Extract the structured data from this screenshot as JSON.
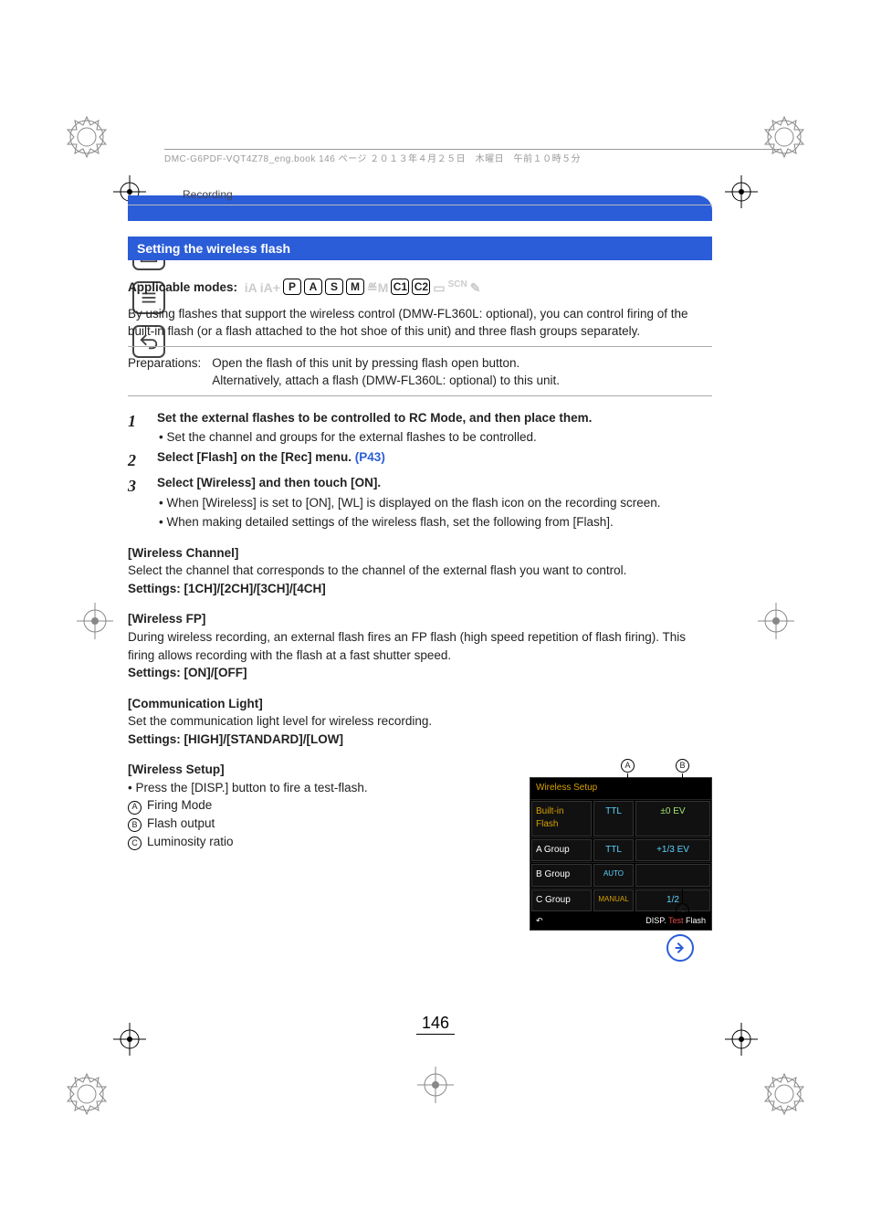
{
  "header_stamp": "DMC-G6PDF-VQT4Z78_eng.book  146 ページ  ２０１３年４月２５日　木曜日　午前１０時５分",
  "section": "Recording",
  "title": "Setting the wireless flash",
  "applicable_label": "Applicable modes:",
  "modes": {
    "dim1": "iA",
    "dim2": "iA+",
    "p": "P",
    "a": "A",
    "s": "S",
    "m": "M",
    "movie": "🎬",
    "c1": "C1",
    "c2": "C2",
    "dim3": "□",
    "dim4": "SCN",
    "dim5": "🎨"
  },
  "intro": "By using flashes that support the wireless control (DMW-FL360L: optional), you can control firing of the built-in flash (or a flash attached to the hot shoe of this unit) and three flash groups separately.",
  "prep_label": "Preparations:",
  "prep_body_1": "Open the flash of this unit by pressing flash open button.",
  "prep_body_2": "Alternatively, attach a flash (DMW-FL360L: optional) to this unit.",
  "steps": {
    "s1": {
      "title": "Set the external flashes to be controlled to RC Mode, and then place them.",
      "sub1": "Set the channel and groups for the external flashes to be controlled."
    },
    "s2": {
      "title_a": "Select [Flash] on the [Rec] menu. ",
      "link": "(P43)"
    },
    "s3": {
      "title": "Select [Wireless] and then touch [ON].",
      "sub1": "When [Wireless] is set to [ON], [WL] is displayed on the flash icon on the recording screen.",
      "sub2": "When making detailed settings of the wireless flash, set the following from [Flash]."
    }
  },
  "wc": {
    "h": "[Wireless Channel]",
    "body": "Select the channel that corresponds to the channel of the external flash you want to control.",
    "set": "Settings: [1CH]/[2CH]/[3CH]/[4CH]"
  },
  "wfp": {
    "h": "[Wireless FP]",
    "body": "During wireless recording, an external flash fires an FP flash (high speed repetition of flash firing). This firing allows recording with the flash at a fast shutter speed.",
    "set": "Settings: [ON]/[OFF]"
  },
  "cl": {
    "h": "[Communication Light]",
    "body": "Set the communication light level for wireless recording.",
    "set": "Settings: [HIGH]/[STANDARD]/[LOW]"
  },
  "ws": {
    "h": "[Wireless Setup]",
    "b1": "Press the [DISP.] button to fire a test-flash.",
    "la": "Firing Mode",
    "lb": "Flash output",
    "lc": "Luminosity ratio"
  },
  "panel": {
    "title": "Wireless Setup",
    "r1": {
      "n": "Built-in Flash",
      "m": "TTL",
      "v": "±0  EV"
    },
    "r2": {
      "n": "A Group",
      "m": "TTL",
      "v": "+1/3 EV"
    },
    "r3": {
      "n": "B Group",
      "m": "AUTO",
      "v": ""
    },
    "r4": {
      "n": "C Group",
      "m": "MANUAL",
      "v": "1/2"
    },
    "foot_back": "↶",
    "foot_disp": "DISP. ",
    "foot_test": "Test ",
    "foot_flash": "Flash"
  },
  "callouts": {
    "A": "A",
    "B": "B",
    "C": "C"
  },
  "page_number": "146"
}
